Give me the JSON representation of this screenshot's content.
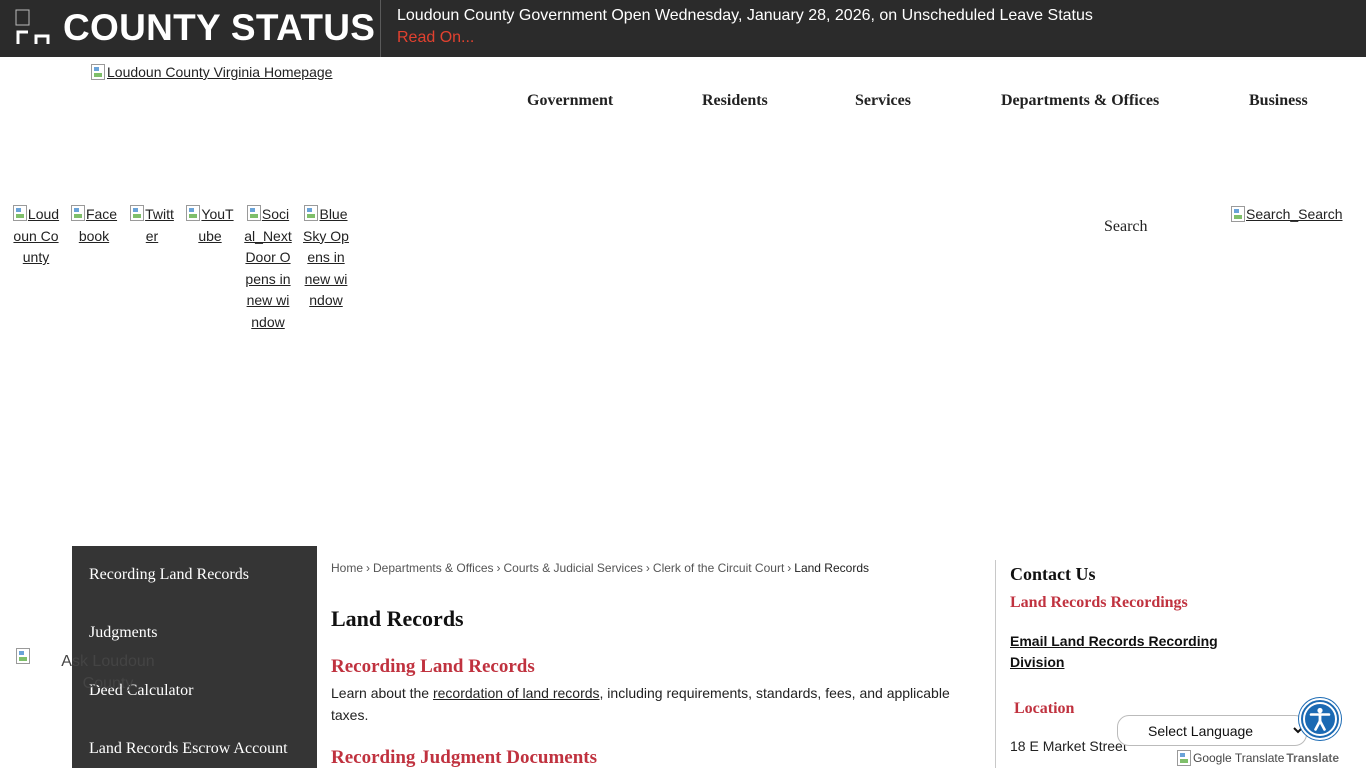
{
  "alert": {
    "title": "COUNTY STATUS",
    "message": "Loudoun County Government Open Wednesday, January 28, 2026, on Unscheduled Leave Status",
    "read_more": "Read On..."
  },
  "header": {
    "logo_alt": "Loudoun County Virginia Homepage",
    "nav": [
      "Government",
      "Residents",
      "Services",
      "Departments & Offices",
      "Business"
    ]
  },
  "social": [
    {
      "label": "Loudoun County"
    },
    {
      "label": "Facebook"
    },
    {
      "label": "Twitter"
    },
    {
      "label": "YouTube"
    },
    {
      "label": "Social_NextDoor Opens in new window"
    },
    {
      "label": "BlueSky Opens in new window"
    }
  ],
  "search": {
    "label": "Search",
    "button_alt": "Search_Search"
  },
  "sidebar": {
    "items": [
      "Recording Land Records",
      "Judgments",
      "Deed Calculator",
      "Land Records Escrow Account"
    ]
  },
  "ask_widget": {
    "label": "Ask Loudoun County"
  },
  "breadcrumb": {
    "items": [
      "Home",
      "Departments & Offices",
      "Courts & Judicial Services",
      "Clerk of the Circuit Court"
    ],
    "current": "Land Records"
  },
  "main": {
    "title": "Land Records",
    "section1": {
      "title": "Recording Land Records",
      "text_before": "Learn about the ",
      "link": "recordation of land records",
      "text_after": ", including requirements, standards, fees, and applicable taxes."
    },
    "section2": {
      "title": "Recording Judgment Documents"
    }
  },
  "contact": {
    "title": "Contact Us",
    "subtitle": "Land Records Recordings",
    "email_link": "Email Land Records Recording Division",
    "location_title": "Location",
    "address": "18 E Market Street"
  },
  "translate": {
    "select_label": "Select Language",
    "google_alt": "Google Translate",
    "translate_text": "Translate"
  },
  "accessibility": {
    "icon": "accessibility-icon"
  },
  "colors": {
    "alert_bg": "#2b2b2b",
    "alert_link": "#e2412f",
    "accent_red": "#c0323f",
    "sidebar_bg": "#353535",
    "access_blue": "#1b6ab3"
  }
}
